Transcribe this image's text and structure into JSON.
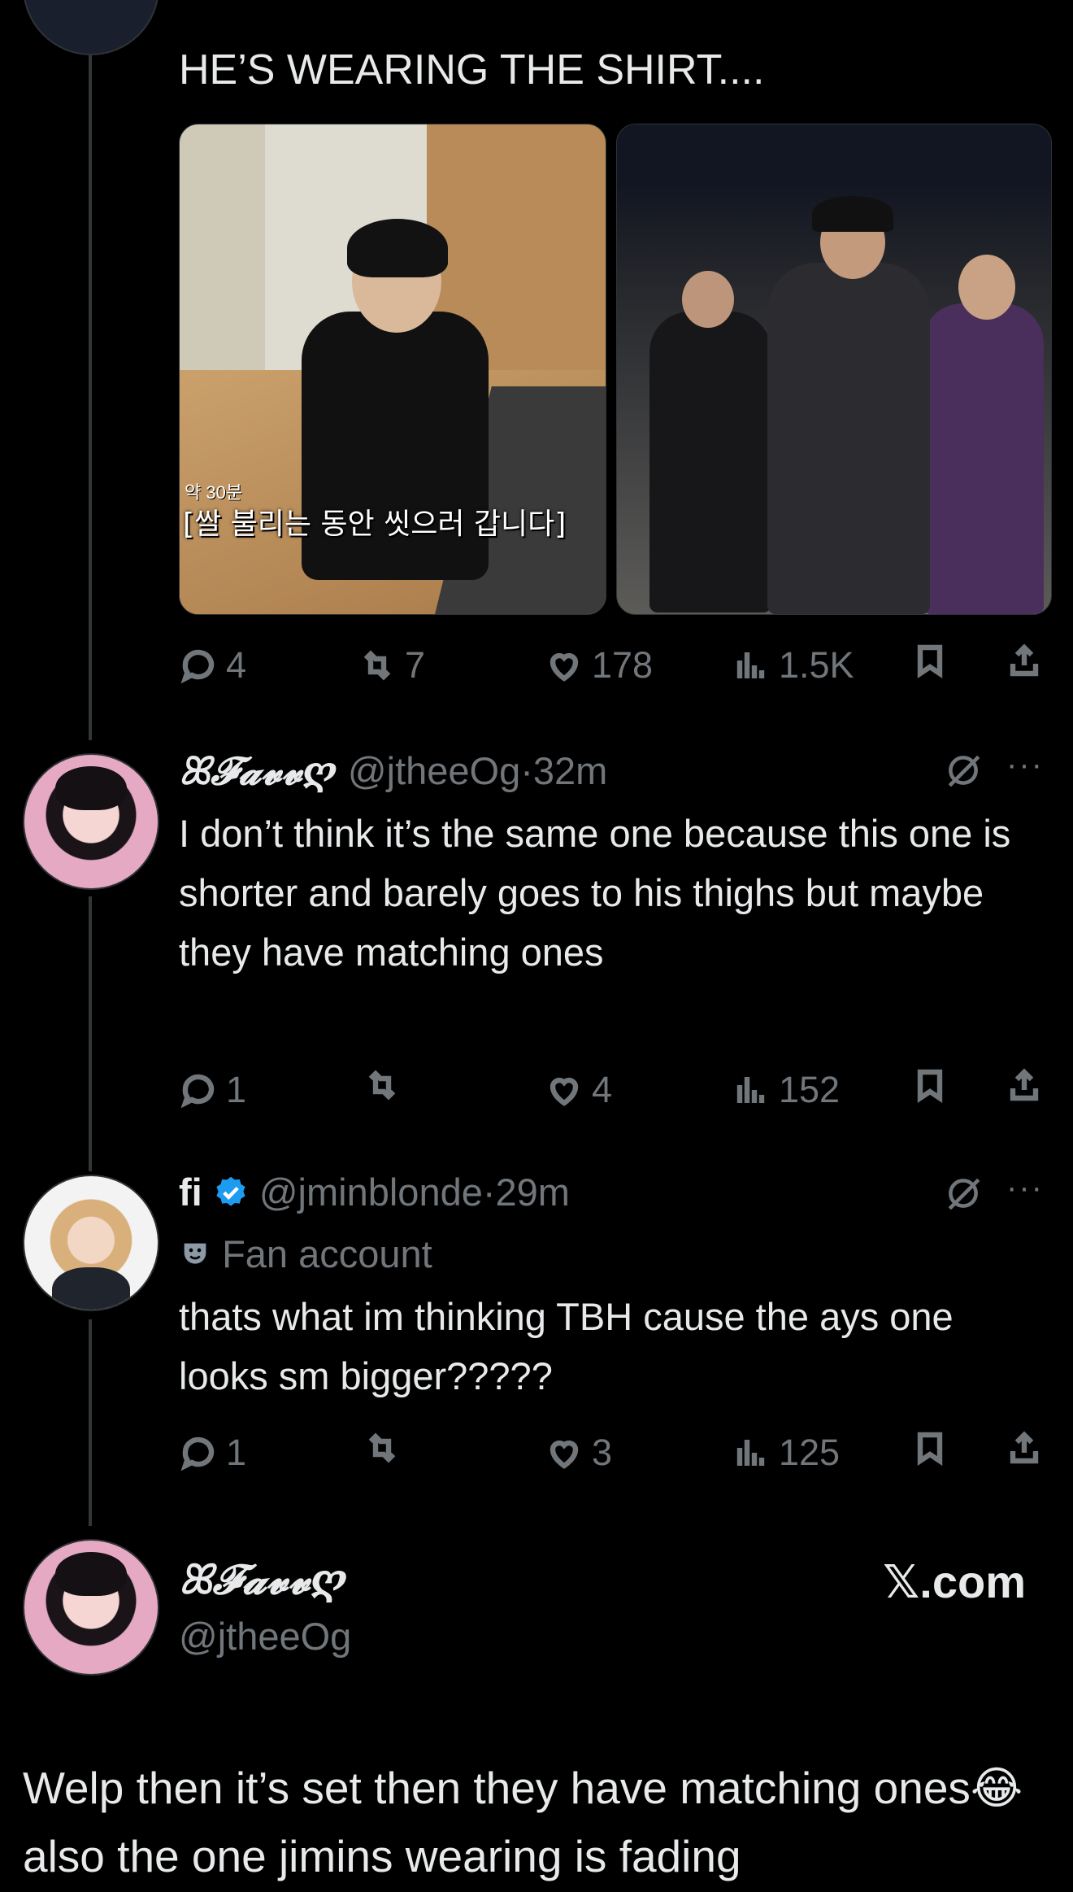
{
  "tweet1": {
    "text": "HE’S WEARING THE SHIRT....",
    "media_subtitle_small": "약 30분",
    "media_subtitle": "[쌀 불리는 동안 씻으러 갑니다]",
    "replies": "4",
    "reposts": "7",
    "likes": "178",
    "views": "1.5K"
  },
  "reply1": {
    "name": "ꕤ𝓕𝓪𝓿𝓿ღ",
    "handle": "@jtheeOg",
    "time": "·32m",
    "text": "I don’t think it’s the same one because this one is shorter and barely goes to his thighs but maybe they have matching ones",
    "replies": "1",
    "reposts": "",
    "likes": "4",
    "views": "152"
  },
  "reply2": {
    "name": "fi",
    "handle": "@jminblonde",
    "time": "·29m",
    "label": "Fan account",
    "text": "thats what im thinking TBH cause the ays one looks sm bigger?????",
    "replies": "1",
    "reposts": "",
    "likes": "3",
    "views": "125"
  },
  "footer": {
    "name": "ꕤ𝓕𝓪𝓿𝓿ღ",
    "handle": "@jtheeOg",
    "brand": "𝕏.com",
    "caption": "Welp then it’s set then they have matching ones😂 also the one jimins wearing is fading"
  },
  "colors": {
    "background": "#000000",
    "text": "#e7e9ea",
    "muted": "#71767b",
    "verified": "#1d9bf0"
  }
}
